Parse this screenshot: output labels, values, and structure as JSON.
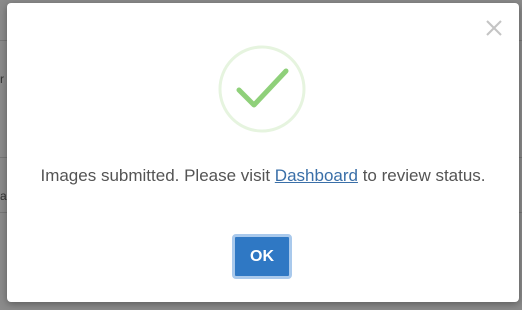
{
  "background": {
    "fragment_1": "r",
    "fragment_2": "a"
  },
  "dialog": {
    "close_icon": "close-x-icon",
    "status_icon": "success-checkmark-icon",
    "message_before": "Images submitted. Please visit ",
    "link_text": "Dashboard",
    "message_after": " to review status.",
    "ok_label": "OK"
  },
  "colors": {
    "accent": "#2f78c4",
    "check": "#8fd07a",
    "check_ring": "#e6f4df",
    "link": "#3a6fa8"
  }
}
